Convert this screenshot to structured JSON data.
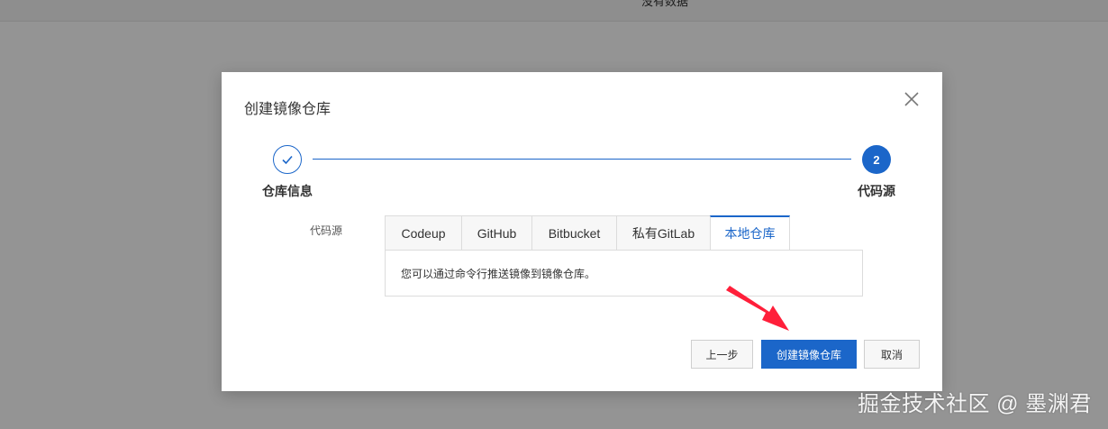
{
  "background": {
    "top_text": "没有数据"
  },
  "dialog": {
    "title": "创建镜像仓库",
    "close_icon": "close-icon"
  },
  "stepper": {
    "steps": [
      {
        "label": "仓库信息",
        "status": "done",
        "icon": "check-icon"
      },
      {
        "label": "代码源",
        "number": "2",
        "status": "active"
      }
    ]
  },
  "form": {
    "source_label": "代码源",
    "tabs": [
      "Codeup",
      "GitHub",
      "Bitbucket",
      "私有GitLab",
      "本地仓库"
    ],
    "active_tab": "本地仓库",
    "panel_text": "您可以通过命令行推送镜像到镜像仓库。"
  },
  "footer": {
    "prev_label": "上一步",
    "create_label": "创建镜像仓库",
    "cancel_label": "取消"
  },
  "colors": {
    "primary": "#1b66c9",
    "arrow": "#ff1f3a"
  },
  "watermark": "掘金技术社区 @ 墨渊君"
}
